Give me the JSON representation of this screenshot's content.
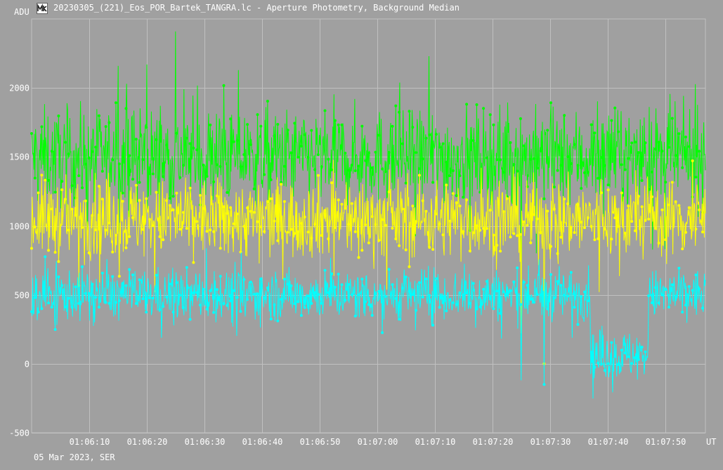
{
  "window": {
    "title": "20230305_(221)_Eos_POR_Bartek_TANGRA.lc - Aperture Photometry, Background Median",
    "icon": "light-curve-app-icon"
  },
  "footer": {
    "date_label": "05 Mar 2023, SER"
  },
  "colors": {
    "background": "#a0a0a0",
    "grid": "#c0c0c0",
    "text": "#ffffff",
    "series_1": "#00ff00",
    "series_2": "#ffff00",
    "series_3": "#00ffff"
  },
  "chart_data": {
    "type": "line",
    "title": "",
    "xlabel": "UT",
    "ylabel": "ADU",
    "x_ticks": [
      "01:06:10",
      "01:06:20",
      "01:06:30",
      "01:06:40",
      "01:06:50",
      "01:07:00",
      "01:07:10",
      "01:07:20",
      "01:07:30",
      "01:07:40",
      "01:07:50"
    ],
    "x_range": [
      "01:06:00",
      "01:07:57"
    ],
    "y_ticks": [
      -500,
      0,
      500,
      1000,
      1500,
      2000
    ],
    "ylim": [
      -500,
      2500
    ],
    "grid": true,
    "marker": "dot",
    "series": [
      {
        "color": "#00ff00",
        "mean": 1500,
        "noise": 170,
        "spikes": [
          {
            "x": "01:06:25",
            "y": 2410
          },
          {
            "x": "01:07:09",
            "y": 2230
          },
          {
            "x": "01:06:20",
            "y": 2170
          },
          {
            "x": "01:06:15",
            "y": 2160
          },
          {
            "x": "01:07:25",
            "y": 60
          }
        ]
      },
      {
        "color": "#ffff00",
        "mean": 1050,
        "noise": 140,
        "spikes": [
          {
            "x": "01:07:29",
            "y": 0
          },
          {
            "x": "01:07:25",
            "y": 220
          }
        ]
      },
      {
        "color": "#00ffff",
        "mean": 500,
        "noise": 90,
        "segments": [
          {
            "from": "01:06:00",
            "to": "01:07:37",
            "mean": 500
          },
          {
            "from": "01:07:37",
            "to": "01:07:47",
            "mean": 60
          },
          {
            "from": "01:07:47",
            "to": "01:07:57",
            "mean": 500
          }
        ],
        "spikes": [
          {
            "x": "01:07:29",
            "y": -150
          },
          {
            "x": "01:07:25",
            "y": -120
          }
        ]
      }
    ]
  }
}
